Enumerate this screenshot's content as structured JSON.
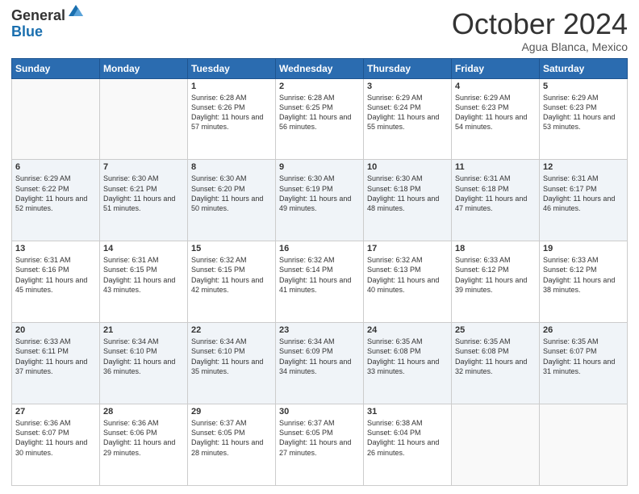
{
  "header": {
    "logo_general": "General",
    "logo_blue": "Blue",
    "month_title": "October 2024",
    "location": "Agua Blanca, Mexico"
  },
  "weekdays": [
    "Sunday",
    "Monday",
    "Tuesday",
    "Wednesday",
    "Thursday",
    "Friday",
    "Saturday"
  ],
  "weeks": [
    [
      {
        "day": "",
        "sunrise": "",
        "sunset": "",
        "daylight": ""
      },
      {
        "day": "",
        "sunrise": "",
        "sunset": "",
        "daylight": ""
      },
      {
        "day": "1",
        "sunrise": "Sunrise: 6:28 AM",
        "sunset": "Sunset: 6:26 PM",
        "daylight": "Daylight: 11 hours and 57 minutes."
      },
      {
        "day": "2",
        "sunrise": "Sunrise: 6:28 AM",
        "sunset": "Sunset: 6:25 PM",
        "daylight": "Daylight: 11 hours and 56 minutes."
      },
      {
        "day": "3",
        "sunrise": "Sunrise: 6:29 AM",
        "sunset": "Sunset: 6:24 PM",
        "daylight": "Daylight: 11 hours and 55 minutes."
      },
      {
        "day": "4",
        "sunrise": "Sunrise: 6:29 AM",
        "sunset": "Sunset: 6:23 PM",
        "daylight": "Daylight: 11 hours and 54 minutes."
      },
      {
        "day": "5",
        "sunrise": "Sunrise: 6:29 AM",
        "sunset": "Sunset: 6:23 PM",
        "daylight": "Daylight: 11 hours and 53 minutes."
      }
    ],
    [
      {
        "day": "6",
        "sunrise": "Sunrise: 6:29 AM",
        "sunset": "Sunset: 6:22 PM",
        "daylight": "Daylight: 11 hours and 52 minutes."
      },
      {
        "day": "7",
        "sunrise": "Sunrise: 6:30 AM",
        "sunset": "Sunset: 6:21 PM",
        "daylight": "Daylight: 11 hours and 51 minutes."
      },
      {
        "day": "8",
        "sunrise": "Sunrise: 6:30 AM",
        "sunset": "Sunset: 6:20 PM",
        "daylight": "Daylight: 11 hours and 50 minutes."
      },
      {
        "day": "9",
        "sunrise": "Sunrise: 6:30 AM",
        "sunset": "Sunset: 6:19 PM",
        "daylight": "Daylight: 11 hours and 49 minutes."
      },
      {
        "day": "10",
        "sunrise": "Sunrise: 6:30 AM",
        "sunset": "Sunset: 6:18 PM",
        "daylight": "Daylight: 11 hours and 48 minutes."
      },
      {
        "day": "11",
        "sunrise": "Sunrise: 6:31 AM",
        "sunset": "Sunset: 6:18 PM",
        "daylight": "Daylight: 11 hours and 47 minutes."
      },
      {
        "day": "12",
        "sunrise": "Sunrise: 6:31 AM",
        "sunset": "Sunset: 6:17 PM",
        "daylight": "Daylight: 11 hours and 46 minutes."
      }
    ],
    [
      {
        "day": "13",
        "sunrise": "Sunrise: 6:31 AM",
        "sunset": "Sunset: 6:16 PM",
        "daylight": "Daylight: 11 hours and 45 minutes."
      },
      {
        "day": "14",
        "sunrise": "Sunrise: 6:31 AM",
        "sunset": "Sunset: 6:15 PM",
        "daylight": "Daylight: 11 hours and 43 minutes."
      },
      {
        "day": "15",
        "sunrise": "Sunrise: 6:32 AM",
        "sunset": "Sunset: 6:15 PM",
        "daylight": "Daylight: 11 hours and 42 minutes."
      },
      {
        "day": "16",
        "sunrise": "Sunrise: 6:32 AM",
        "sunset": "Sunset: 6:14 PM",
        "daylight": "Daylight: 11 hours and 41 minutes."
      },
      {
        "day": "17",
        "sunrise": "Sunrise: 6:32 AM",
        "sunset": "Sunset: 6:13 PM",
        "daylight": "Daylight: 11 hours and 40 minutes."
      },
      {
        "day": "18",
        "sunrise": "Sunrise: 6:33 AM",
        "sunset": "Sunset: 6:12 PM",
        "daylight": "Daylight: 11 hours and 39 minutes."
      },
      {
        "day": "19",
        "sunrise": "Sunrise: 6:33 AM",
        "sunset": "Sunset: 6:12 PM",
        "daylight": "Daylight: 11 hours and 38 minutes."
      }
    ],
    [
      {
        "day": "20",
        "sunrise": "Sunrise: 6:33 AM",
        "sunset": "Sunset: 6:11 PM",
        "daylight": "Daylight: 11 hours and 37 minutes."
      },
      {
        "day": "21",
        "sunrise": "Sunrise: 6:34 AM",
        "sunset": "Sunset: 6:10 PM",
        "daylight": "Daylight: 11 hours and 36 minutes."
      },
      {
        "day": "22",
        "sunrise": "Sunrise: 6:34 AM",
        "sunset": "Sunset: 6:10 PM",
        "daylight": "Daylight: 11 hours and 35 minutes."
      },
      {
        "day": "23",
        "sunrise": "Sunrise: 6:34 AM",
        "sunset": "Sunset: 6:09 PM",
        "daylight": "Daylight: 11 hours and 34 minutes."
      },
      {
        "day": "24",
        "sunrise": "Sunrise: 6:35 AM",
        "sunset": "Sunset: 6:08 PM",
        "daylight": "Daylight: 11 hours and 33 minutes."
      },
      {
        "day": "25",
        "sunrise": "Sunrise: 6:35 AM",
        "sunset": "Sunset: 6:08 PM",
        "daylight": "Daylight: 11 hours and 32 minutes."
      },
      {
        "day": "26",
        "sunrise": "Sunrise: 6:35 AM",
        "sunset": "Sunset: 6:07 PM",
        "daylight": "Daylight: 11 hours and 31 minutes."
      }
    ],
    [
      {
        "day": "27",
        "sunrise": "Sunrise: 6:36 AM",
        "sunset": "Sunset: 6:07 PM",
        "daylight": "Daylight: 11 hours and 30 minutes."
      },
      {
        "day": "28",
        "sunrise": "Sunrise: 6:36 AM",
        "sunset": "Sunset: 6:06 PM",
        "daylight": "Daylight: 11 hours and 29 minutes."
      },
      {
        "day": "29",
        "sunrise": "Sunrise: 6:37 AM",
        "sunset": "Sunset: 6:05 PM",
        "daylight": "Daylight: 11 hours and 28 minutes."
      },
      {
        "day": "30",
        "sunrise": "Sunrise: 6:37 AM",
        "sunset": "Sunset: 6:05 PM",
        "daylight": "Daylight: 11 hours and 27 minutes."
      },
      {
        "day": "31",
        "sunrise": "Sunrise: 6:38 AM",
        "sunset": "Sunset: 6:04 PM",
        "daylight": "Daylight: 11 hours and 26 minutes."
      },
      {
        "day": "",
        "sunrise": "",
        "sunset": "",
        "daylight": ""
      },
      {
        "day": "",
        "sunrise": "",
        "sunset": "",
        "daylight": ""
      }
    ]
  ]
}
